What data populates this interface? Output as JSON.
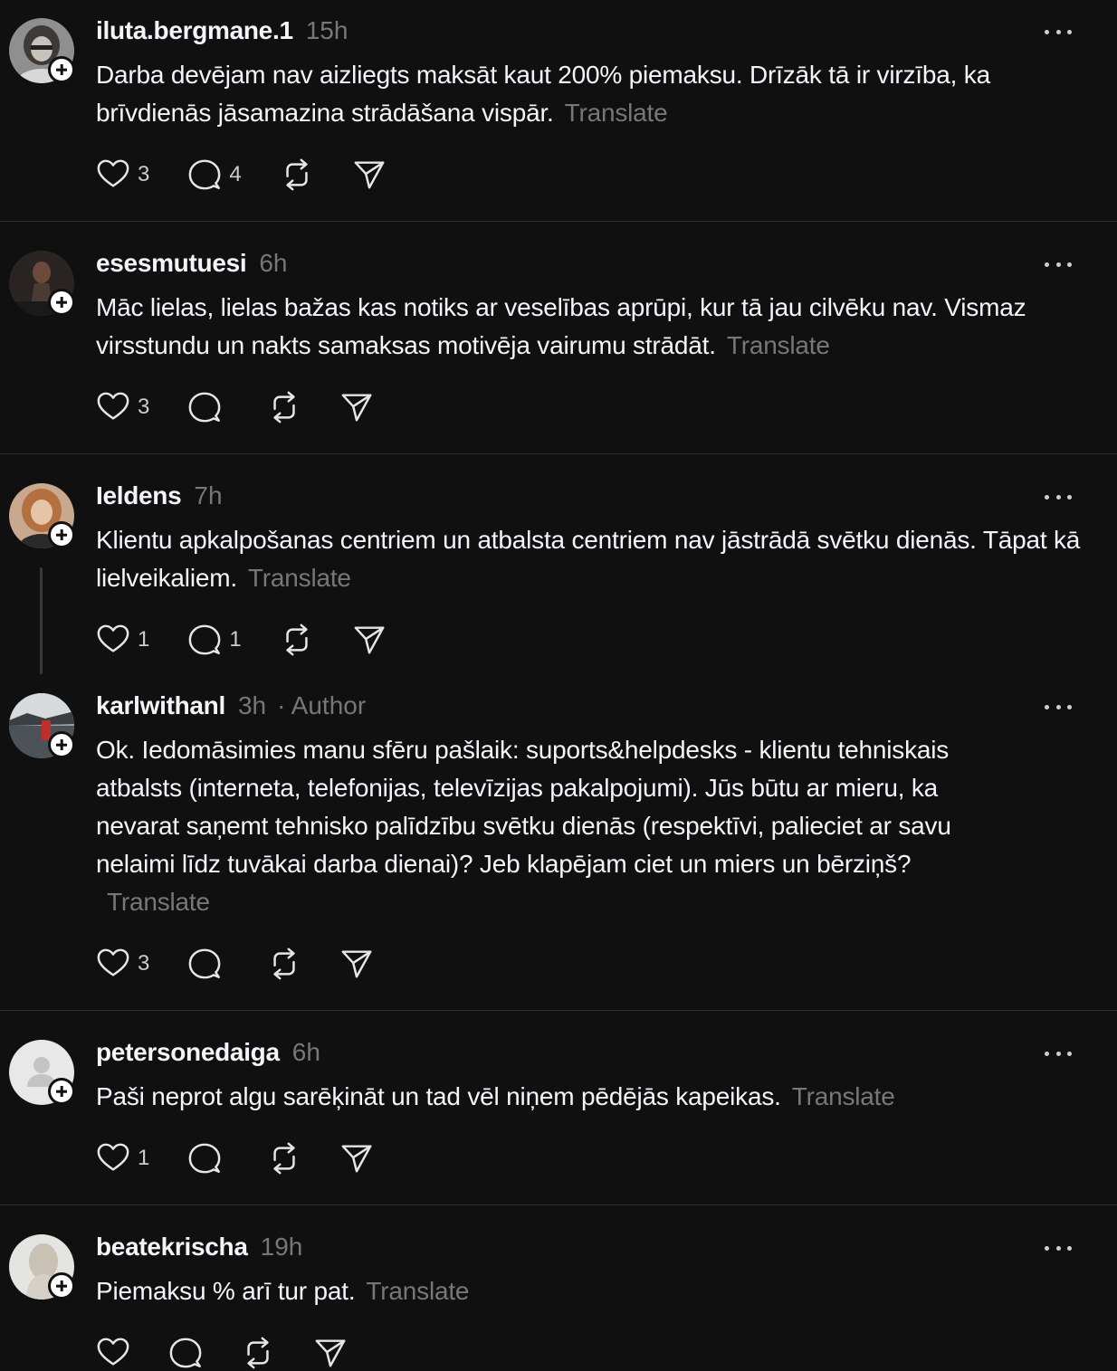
{
  "posts": [
    {
      "username": "iluta.bergmane.1",
      "time": "15h",
      "text": "Darba devējam nav aizliegts maksāt kaut 200% piemaksu. Drīzāk tā ir virzība, ka brīvdienās jāsamazina strādāšana vispār.",
      "translate": "Translate",
      "likes": "3",
      "replies": "4"
    },
    {
      "username": "esesmutuesi",
      "time": "6h",
      "text": "Māc lielas, lielas bažas kas notiks ar veselības aprūpi, kur tā jau cilvēku nav. Vismaz virsstundu un nakts samaksas motivēja vairumu strādāt.",
      "translate": "Translate",
      "likes": "3",
      "replies": ""
    },
    {
      "username": "Ieldens",
      "time": "7h",
      "text": "Klientu apkalpošanas centriem un atbalsta centriem nav jāstrādā svētku dienās. Tāpat kā lielveikaliem.",
      "translate": "Translate",
      "likes": "1",
      "replies": "1"
    },
    {
      "username": "karlwithanl",
      "time": "3h",
      "author": "· Author",
      "text": "Ok. Iedomāsimies manu sfēru pašlaik: suports&helpdesks - klientu tehniskais atbalsts (interneta, telefonijas, televīzijas pakalpojumi). Jūs būtu ar mieru, ka nevarat saņemt tehnisko palīdzību svētku dienās (respektīvi, palieciet ar savu nelaimi līdz tuvākai darba dienai)? Jeb klapējam ciet un miers un bērziņš?",
      "translate": "Translate",
      "likes": "3",
      "replies": ""
    },
    {
      "username": "petersonedaiga",
      "time": "6h",
      "text": "Paši neprot algu sarēķināt un tad vēl niņem pēdējās kapeikas.",
      "translate": "Translate",
      "likes": "1",
      "replies": ""
    },
    {
      "username": "beatekrischa",
      "time": "19h",
      "text": "Piemaksu % arī tur pat.",
      "translate": "Translate",
      "likes": "",
      "replies": ""
    }
  ]
}
